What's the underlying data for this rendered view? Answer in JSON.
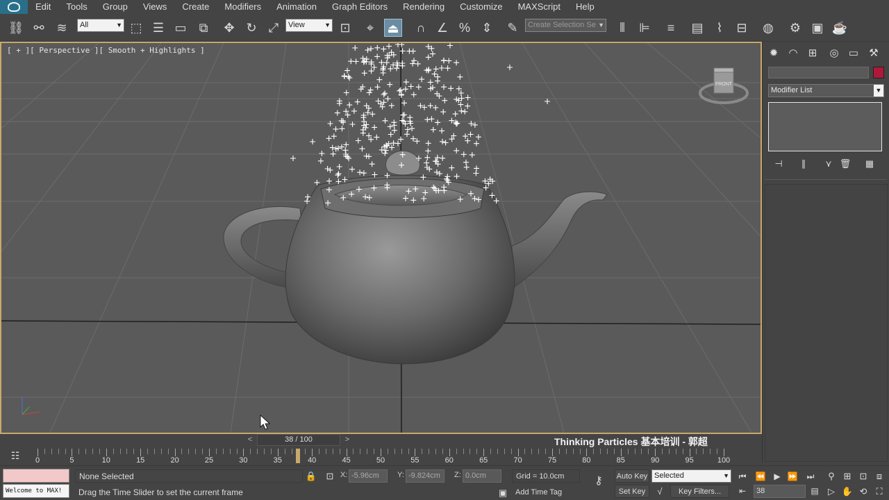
{
  "menu": {
    "items": [
      "Edit",
      "Tools",
      "Group",
      "Views",
      "Create",
      "Modifiers",
      "Animation",
      "Graph Editors",
      "Rendering",
      "Customize",
      "MAXScript",
      "Help"
    ]
  },
  "toolbar": {
    "selection_filter": "All",
    "reference_coord": "View",
    "named_selection_placeholder": "Create Selection Se"
  },
  "viewport": {
    "label": "[ + ][ Perspective ][ Smooth + Highlights ]",
    "viewcube_label": "FRONT"
  },
  "command_panel": {
    "modifier_list": "Modifier List",
    "object_color": "#b0183a"
  },
  "timeslider": {
    "prev": "<",
    "position": "38 / 100",
    "next": ">",
    "current_frame": 38,
    "total_frames": 100,
    "watermark": "Thinking Particles 基本培训 - 郭超"
  },
  "trackbar": {
    "tick_labels": [
      "0",
      "5",
      "10",
      "15",
      "20",
      "25",
      "30",
      "35",
      "40",
      "45",
      "50",
      "55",
      "60",
      "65",
      "70",
      "75",
      "80",
      "85",
      "90",
      "95",
      "100"
    ]
  },
  "status": {
    "welcome": "Welcome to MAX!",
    "selection": "None Selected",
    "prompt": "Drag the Time Slider to set the current frame",
    "x_label": "X:",
    "x_value": "-5.96cm",
    "y_label": "Y:",
    "y_value": "-9.824cm",
    "z_label": "Z:",
    "z_value": "0.0cm",
    "grid": "Grid = 10.0cm",
    "add_time_tag": "Add Time Tag",
    "auto_key": "Auto Key",
    "set_key": "Set Key",
    "key_filter_value": "Selected",
    "key_filters": "Key Filters...",
    "frame_value": "38"
  }
}
